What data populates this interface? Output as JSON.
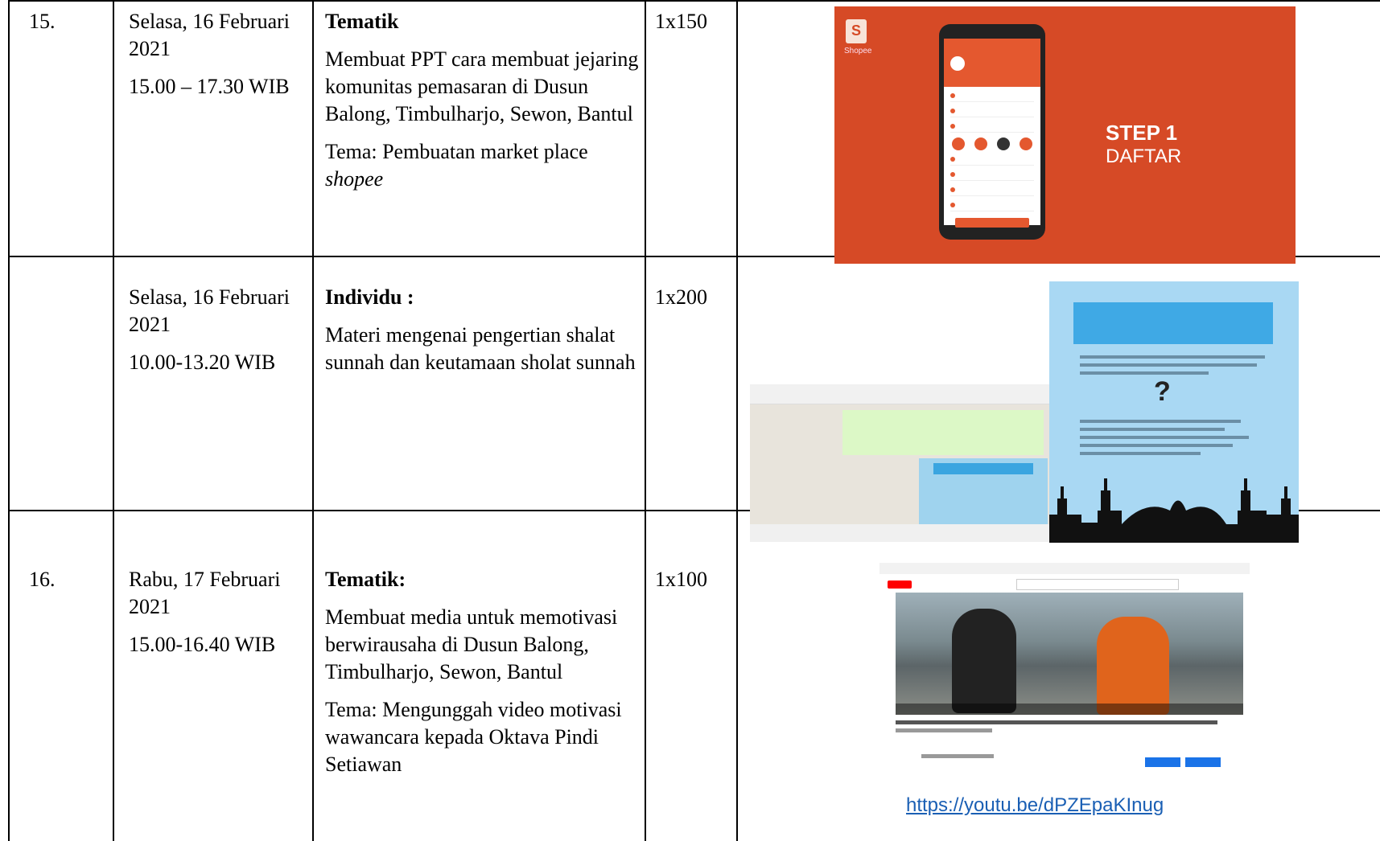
{
  "rows": [
    {
      "no": "15.",
      "date": "Selasa, 16 Februari 2021",
      "time": "15.00 – 17.30 WIB",
      "kind": "Tematik",
      "desc": "Membuat PPT cara membuat jejaring komunitas pemasaran di Dusun Balong, Timbulharjo, Sewon, Bantul",
      "theme_prefix": "Tema: Pembuatan market place ",
      "theme_italic": "shopee",
      "qty": "1x150",
      "image": {
        "step_title": "STEP 1",
        "step_sub": "DAFTAR",
        "brand": "Shopee"
      }
    },
    {
      "no": "",
      "date": "Selasa, 16 Februari 2021",
      "time": "10.00-13.20 WIB",
      "kind": "Individu :",
      "desc": "Materi mengenai pengertian shalat sunnah dan keutamaan sholat sunnah",
      "qty": "1x200"
    },
    {
      "no": "16.",
      "date": "Rabu, 17 Februari 2021",
      "time": "15.00-16.40 WIB",
      "kind": "Tematik:",
      "desc": "Membuat media untuk memotivasi berwirausaha di Dusun Balong, Timbulharjo, Sewon, Bantul",
      "theme": "Tema: Mengunggah video motivasi wawancara kepada Oktava Pindi Setiawan",
      "qty": "1x100",
      "link": "https://youtu.be/dPZEpaKInug"
    }
  ]
}
